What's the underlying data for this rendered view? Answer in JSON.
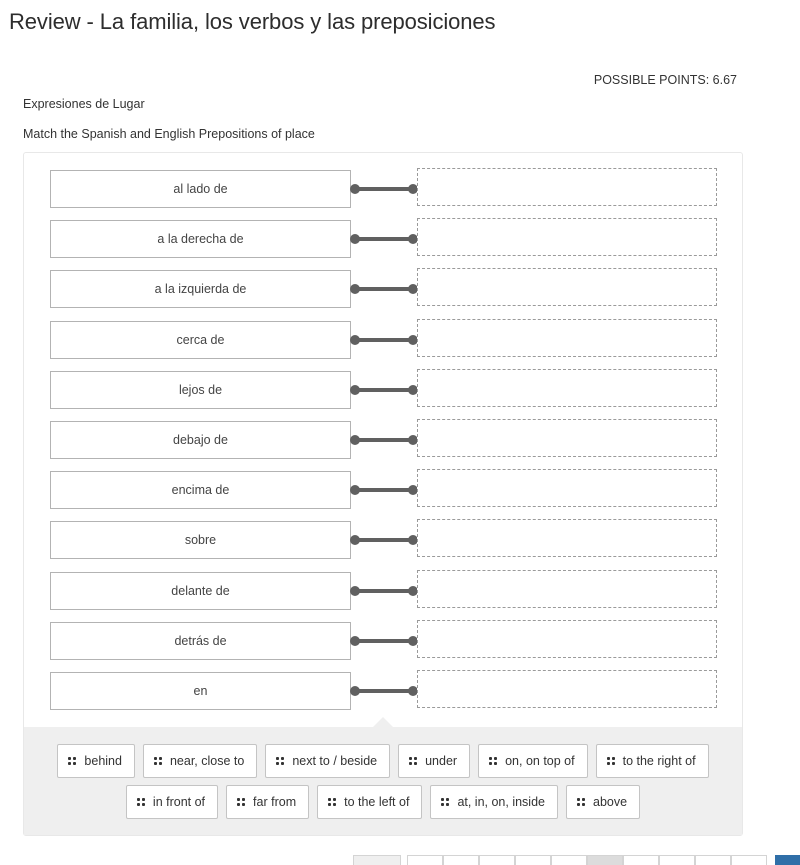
{
  "page": {
    "title": "Review - La familia, los verbos y las preposiciones",
    "possible_points_label": "POSSIBLE POINTS: 6.67"
  },
  "question": {
    "title": "Expresiones de Lugar",
    "instructions": "Match the Spanish and English Prepositions of place",
    "prompts": [
      {
        "label": "al lado de",
        "answer": ""
      },
      {
        "label": "a la derecha de",
        "answer": ""
      },
      {
        "label": "a la izquierda de",
        "answer": ""
      },
      {
        "label": "cerca de",
        "answer": ""
      },
      {
        "label": "lejos de",
        "answer": ""
      },
      {
        "label": "debajo de",
        "answer": ""
      },
      {
        "label": "encima de",
        "answer": ""
      },
      {
        "label": "sobre",
        "answer": ""
      },
      {
        "label": "delante de",
        "answer": ""
      },
      {
        "label": "detrás de",
        "answer": ""
      },
      {
        "label": "en",
        "answer": ""
      }
    ],
    "answer_bank": [
      "behind",
      "near, close to",
      "next to / beside",
      "under",
      "on, on top of",
      "to the right of",
      "in front of",
      "far from",
      "to the left of",
      "at, in, on, inside",
      "above"
    ]
  },
  "icons": {
    "chip_handle": "drag-handle-icon",
    "connector": "link-connector-icon"
  },
  "colors": {
    "connector": "#606060",
    "bank_background": "#efefef",
    "next_button": "#2f6fa8"
  }
}
